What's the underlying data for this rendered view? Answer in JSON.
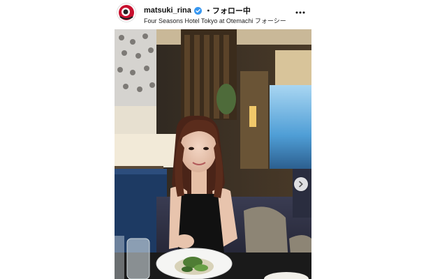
{
  "post": {
    "username": "matsuki_rina",
    "follow_label": "・フォロー中",
    "location": "Four Seasons Hotel Tokyo at Otemachi フォーシー"
  },
  "icons": {
    "verified": "verified-badge-icon",
    "more": "more-options-icon",
    "next": "chevron-right-icon"
  },
  "colors": {
    "verified": "#3897f0",
    "avatar_accent": "#c8102e"
  }
}
